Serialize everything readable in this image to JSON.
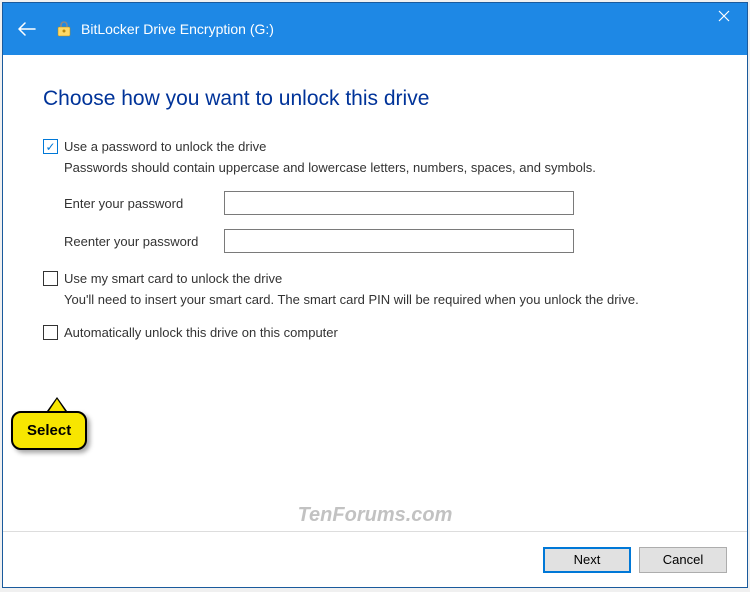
{
  "header": {
    "title": "BitLocker Drive Encryption (G:)"
  },
  "page": {
    "heading": "Choose how you want to unlock this drive"
  },
  "options": {
    "use_password": {
      "label": "Use a password to unlock the drive",
      "checked": true,
      "hint": "Passwords should contain uppercase and lowercase letters, numbers, spaces, and symbols.",
      "enter_label": "Enter your password",
      "reenter_label": "Reenter your password",
      "enter_value": "",
      "reenter_value": ""
    },
    "use_smartcard": {
      "label": "Use my smart card to unlock the drive",
      "checked": false,
      "hint": "You'll need to insert your smart card. The smart card PIN will be required when you unlock the drive."
    },
    "auto_unlock": {
      "label": "Automatically unlock this drive on this computer",
      "checked": false
    }
  },
  "buttons": {
    "next": "Next",
    "cancel": "Cancel"
  },
  "callout": {
    "text": "Select"
  },
  "watermark": "TenForums.com"
}
